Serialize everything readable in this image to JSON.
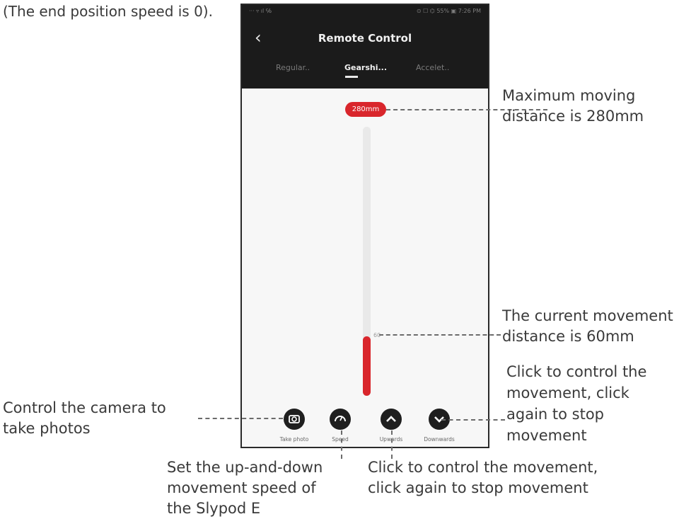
{
  "top_note": "(The end position speed is 0).",
  "phone": {
    "status_left": "···  ▿ ıl ℅",
    "status_right": "⊙ ☐ ⌬ 55% ▣ 7:26 PM",
    "title": "Remote Control",
    "tabs": [
      {
        "label": "Regular..",
        "active": false
      },
      {
        "label": "Gearshi...",
        "active": true
      },
      {
        "label": "Accelet..",
        "active": false
      }
    ],
    "max_badge": "280mm",
    "current_label": "60",
    "current_distance_mm": 60,
    "max_distance_mm": 280,
    "buttons": [
      {
        "label": "Take photo",
        "icon": "camera-icon"
      },
      {
        "label": "Speed",
        "icon": "speed-gauge-icon"
      },
      {
        "label": "Upwards",
        "icon": "chevron-up-icon"
      },
      {
        "label": "Downwards",
        "icon": "chevron-down-icon"
      }
    ]
  },
  "annotations": {
    "max_distance": [
      "Maximum moving",
      "distance is 280mm"
    ],
    "current_distance": [
      "The current movement",
      "distance is 60mm"
    ],
    "click_right": [
      "Click to control the",
      "movement, click",
      "again to stop",
      "movement"
    ],
    "camera": [
      "Control the camera to",
      "take photos"
    ],
    "speed": [
      "Set the up-and-down",
      "movement speed of",
      "the Slypod E"
    ],
    "click_bottom": [
      "Click to control the movement,",
      "click again to stop movement"
    ]
  },
  "colors": {
    "accent": "#d9262c",
    "appbar": "#1b1b1b",
    "button": "#1f1f1f"
  }
}
